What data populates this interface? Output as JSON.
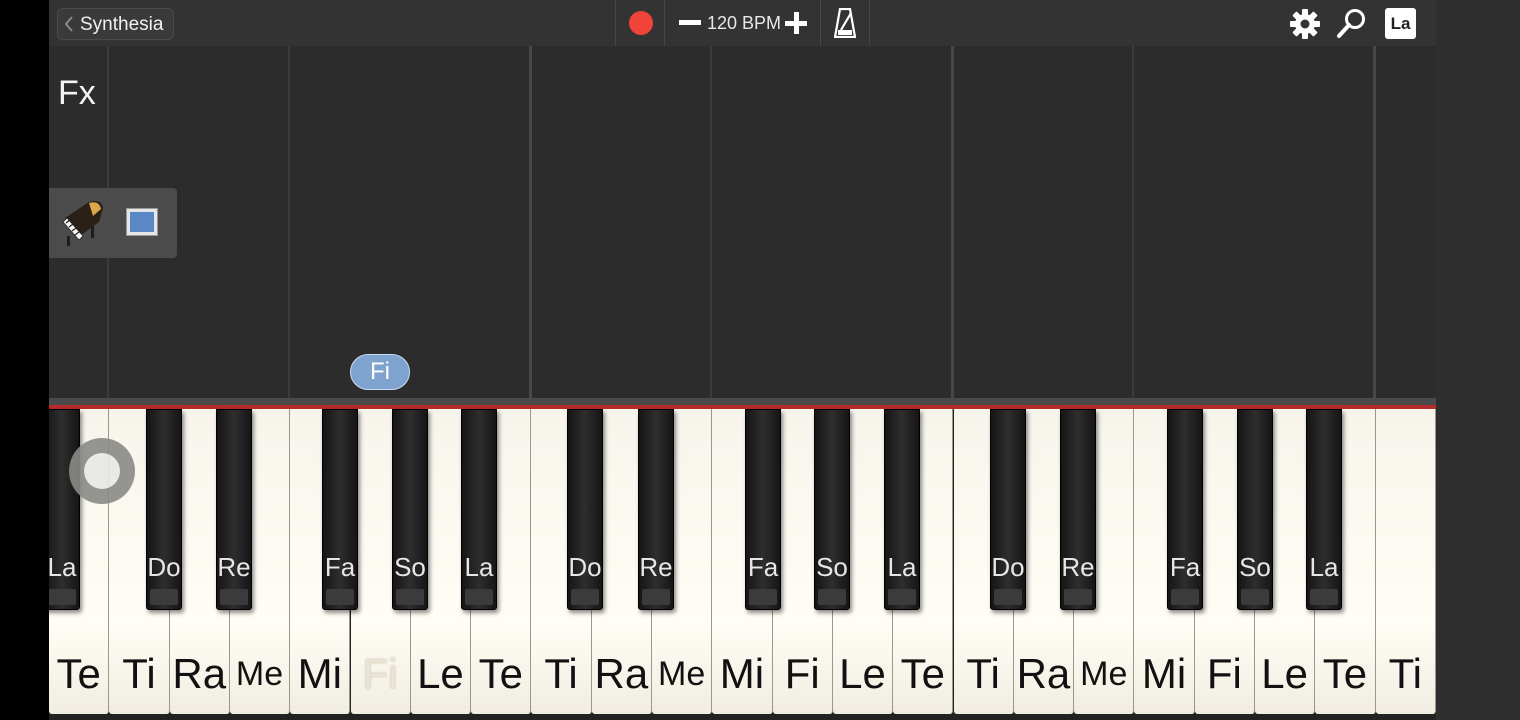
{
  "topbar": {
    "back_label": "Synthesia",
    "bpm_label": "120 BPM",
    "label_toggle": "La",
    "record_color": "#f0433a"
  },
  "track": {
    "fx_label": "Fx",
    "note_bubble": "Fi",
    "instrument_icon": "grand-piano-icon",
    "screen_icon": "screen-icon"
  },
  "keyboard": {
    "white_keys": [
      "Te",
      "Ti",
      "Ra",
      "Me",
      "Mi",
      "Fi",
      "Le",
      "Te",
      "Ti",
      "Ra",
      "Me",
      "Mi",
      "Fi",
      "Le",
      "Te",
      "Ti",
      "Ra",
      "Me",
      "Mi",
      "Fi",
      "Le",
      "Te",
      "Ti"
    ],
    "black_keys": [
      "La",
      "Do",
      "Re",
      "Fa",
      "So",
      "La",
      "Do",
      "Re",
      "Fa",
      "So",
      "La",
      "Do",
      "Re",
      "Fa",
      "So",
      "La"
    ]
  }
}
